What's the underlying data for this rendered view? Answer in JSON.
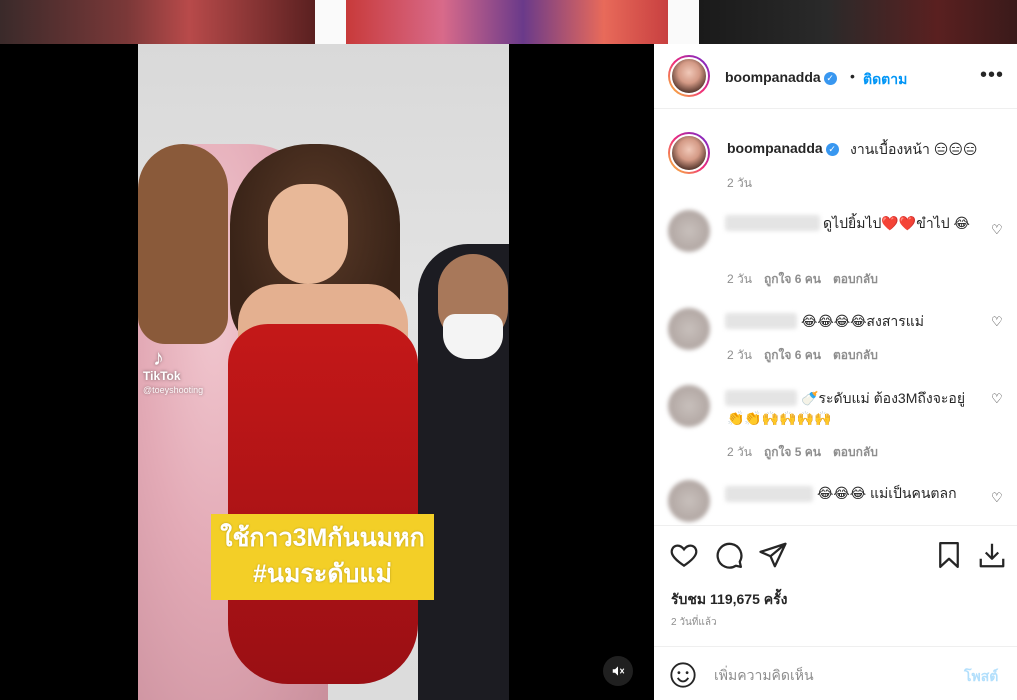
{
  "video": {
    "watermark_brand": "TikTok",
    "watermark_handle": "@toeyshooting",
    "caption_line1": "ใช้กาว3Mกันนมหก",
    "caption_line2": "#นมระดับแม่"
  },
  "header": {
    "username": "boompanadda",
    "separator": "•",
    "follow_label": "ติดตาม",
    "more_label": "•••"
  },
  "post_caption": {
    "username": "boompanadda",
    "text": "งานเบื้องหน้า 😑😑😑",
    "time": "2 วัน"
  },
  "comments": [
    {
      "text": "ดูไปยิ้มไป❤️❤️ขำไป 😂",
      "time": "2 วัน",
      "likes": "ถูกใจ 6 คน",
      "reply": "ตอบกลับ"
    },
    {
      "text": "😂😂😂😂สงสารแม่",
      "time": "2 วัน",
      "likes": "ถูกใจ 6 คน",
      "reply": "ตอบกลับ"
    },
    {
      "text": "🍼ระดับแม่ ต้อง3Mถึงจะอยู่ 👏👏🙌🙌🙌🙌",
      "time": "2 วัน",
      "likes": "ถูกใจ 5 คน",
      "reply": "ตอบกลับ"
    },
    {
      "text": "😂😂😂 แม่เป็นคนตลก",
      "time": "",
      "likes": "",
      "reply": ""
    }
  ],
  "stats": {
    "views": "รับชม 119,675 ครั้ง",
    "posted": "2 วันที่แล้ว"
  },
  "add_comment": {
    "placeholder": "เพิ่มความคิดเห็น",
    "post_label": "โพสต์"
  }
}
